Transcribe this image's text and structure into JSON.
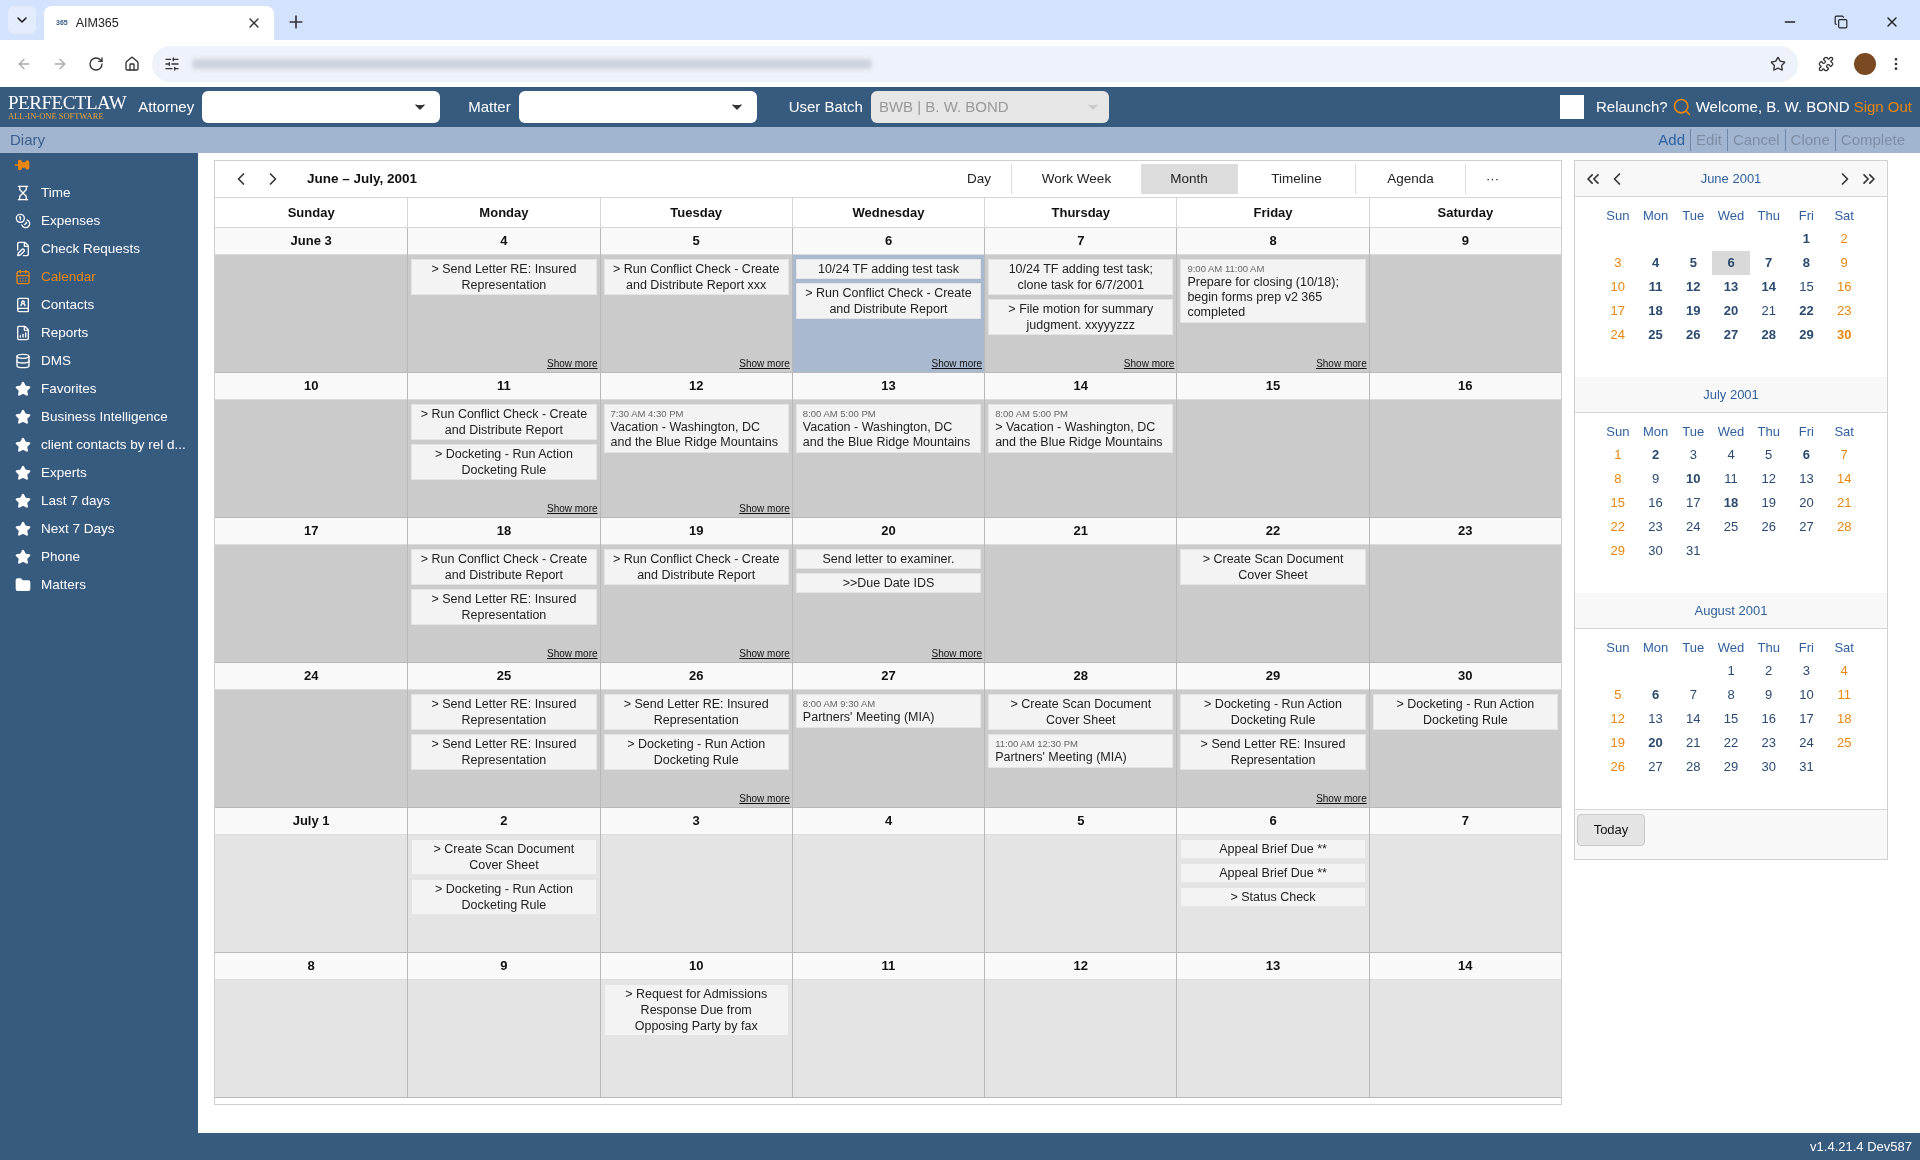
{
  "browser": {
    "tab_title": "AIM365",
    "favicon": "365"
  },
  "header": {
    "logo_top": "PERFECTLAW",
    "logo_bottom": "ALL-IN-ONE SOFTWARE",
    "attorney_label": "Attorney",
    "matter_label": "Matter",
    "batch_label": "User Batch",
    "batch_value": "BWB | B. W. BOND",
    "batch_disabled": true,
    "relaunch_checked": false,
    "relaunch_label": "Relaunch?",
    "welcome": "Welcome, B. W. BOND",
    "sign_out": "Sign Out"
  },
  "toolbar": {
    "title": "Diary",
    "actions": [
      {
        "label": "Add",
        "disabled": false
      },
      {
        "label": "Edit",
        "disabled": true
      },
      {
        "label": "Cancel",
        "disabled": true
      },
      {
        "label": "Clone",
        "disabled": true
      },
      {
        "label": "Complete",
        "disabled": true
      }
    ]
  },
  "sidebar": {
    "items": [
      {
        "label": "Time",
        "selected": false
      },
      {
        "label": "Expenses",
        "selected": false
      },
      {
        "label": "Check Requests",
        "selected": false
      },
      {
        "label": "Calendar",
        "selected": true
      },
      {
        "label": "Contacts",
        "selected": false
      },
      {
        "label": "Reports",
        "selected": false
      },
      {
        "label": "DMS",
        "selected": false
      },
      {
        "label": "Favorites",
        "selected": false
      },
      {
        "label": "Business Intelligence",
        "selected": false
      },
      {
        "label": "client contacts by rel d...",
        "selected": false
      },
      {
        "label": "Experts",
        "selected": false
      },
      {
        "label": "Last 7 days",
        "selected": false
      },
      {
        "label": "Next 7 Days",
        "selected": false
      },
      {
        "label": "Phone",
        "selected": false
      },
      {
        "label": "Matters",
        "selected": false
      }
    ]
  },
  "calendar": {
    "title": "June – July, 2001",
    "more": "···",
    "views": [
      {
        "label": "Day",
        "selected": false
      },
      {
        "label": "Work Week",
        "selected": false
      },
      {
        "label": "Month",
        "selected": true
      },
      {
        "label": "Timeline",
        "selected": false
      },
      {
        "label": "Agenda",
        "selected": false
      }
    ],
    "weekdays": [
      "Sunday",
      "Monday",
      "Tuesday",
      "Wednesday",
      "Thursday",
      "Friday",
      "Saturday"
    ],
    "weeks": [
      {
        "days": [
          {
            "date": "June 3",
            "in_month": true,
            "selected": false
          },
          {
            "date": "4",
            "in_month": true,
            "selected": false,
            "more": "Show more",
            "events": [
              {
                "kind": "task",
                "text": "> Send Letter RE: Insured Representation"
              }
            ]
          },
          {
            "date": "5",
            "in_month": true,
            "selected": false,
            "more": "Show more",
            "events": [
              {
                "kind": "task",
                "text": "> Run Conflict Check - Create and Distribute Report xxx"
              }
            ]
          },
          {
            "date": "6",
            "in_month": true,
            "selected": true,
            "more": "Show more",
            "events": [
              {
                "kind": "task",
                "text": "10/24 TF adding test task"
              },
              {
                "kind": "task",
                "text": "> Run Conflict Check - Create and Distribute Report"
              }
            ]
          },
          {
            "date": "7",
            "in_month": true,
            "selected": false,
            "more": "Show more",
            "events": [
              {
                "kind": "task",
                "text": "10/24 TF adding test task; clone task for 6/7/2001"
              },
              {
                "kind": "task",
                "text": "> File motion for summary judgment. xxyyyzzz"
              }
            ]
          },
          {
            "date": "8",
            "in_month": true,
            "selected": false,
            "more": "Show more",
            "events": [
              {
                "kind": "appointment",
                "time": "9:00 AM 11:00 AM",
                "text": "Prepare for closing (10/18); begin forms prep v2 365 completed"
              }
            ]
          },
          {
            "date": "9",
            "in_month": true,
            "selected": false
          }
        ]
      },
      {
        "days": [
          {
            "date": "10",
            "in_month": true,
            "selected": false
          },
          {
            "date": "11",
            "in_month": true,
            "selected": false,
            "more": "Show more",
            "events": [
              {
                "kind": "task",
                "text": "> Run Conflict Check - Create and Distribute Report"
              },
              {
                "kind": "task",
                "text": "> Docketing - Run Action Docketing Rule"
              }
            ]
          },
          {
            "date": "12",
            "in_month": true,
            "selected": false,
            "more": "Show more",
            "events": [
              {
                "kind": "appointment",
                "time": "7:30 AM 4:30 PM",
                "text": "Vacation - Washington, DC and the Blue Ridge Mountains"
              }
            ]
          },
          {
            "date": "13",
            "in_month": true,
            "selected": false,
            "events": [
              {
                "kind": "appointment",
                "time": "8:00 AM 5:00 PM",
                "text": "Vacation - Washington, DC and the Blue Ridge Mountains"
              }
            ]
          },
          {
            "date": "14",
            "in_month": true,
            "selected": false,
            "events": [
              {
                "kind": "appointment",
                "time": "8:00 AM 5:00 PM",
                "text": "> Vacation - Washington, DC and the Blue Ridge Mountains"
              }
            ]
          },
          {
            "date": "15",
            "in_month": true,
            "selected": false
          },
          {
            "date": "16",
            "in_month": true,
            "selected": false
          }
        ]
      },
      {
        "days": [
          {
            "date": "17",
            "in_month": true,
            "selected": false
          },
          {
            "date": "18",
            "in_month": true,
            "selected": false,
            "more": "Show more",
            "events": [
              {
                "kind": "task",
                "text": "> Run Conflict Check - Create and Distribute Report"
              },
              {
                "kind": "task",
                "text": "> Send Letter RE: Insured Representation"
              }
            ]
          },
          {
            "date": "19",
            "in_month": true,
            "selected": false,
            "more": "Show more",
            "events": [
              {
                "kind": "task",
                "text": "> Run Conflict Check - Create and Distribute Report"
              }
            ]
          },
          {
            "date": "20",
            "in_month": true,
            "selected": false,
            "more": "Show more",
            "events": [
              {
                "kind": "task",
                "text": "Send letter to examiner."
              },
              {
                "kind": "task",
                "text": ">>Due Date IDS"
              }
            ]
          },
          {
            "date": "21",
            "in_month": true,
            "selected": false
          },
          {
            "date": "22",
            "in_month": true,
            "selected": false,
            "events": [
              {
                "kind": "task",
                "text": "> Create Scan Document Cover Sheet"
              }
            ]
          },
          {
            "date": "23",
            "in_month": true,
            "selected": false
          }
        ]
      },
      {
        "days": [
          {
            "date": "24",
            "in_month": true,
            "selected": false
          },
          {
            "date": "25",
            "in_month": true,
            "selected": false,
            "events": [
              {
                "kind": "task",
                "text": "> Send Letter RE: Insured Representation"
              },
              {
                "kind": "task",
                "text": "> Send Letter RE: Insured Representation"
              }
            ]
          },
          {
            "date": "26",
            "in_month": true,
            "selected": false,
            "more": "Show more",
            "events": [
              {
                "kind": "task",
                "text": "> Send Letter RE: Insured Representation"
              },
              {
                "kind": "task",
                "text": "> Docketing - Run Action Docketing Rule"
              }
            ]
          },
          {
            "date": "27",
            "in_month": true,
            "selected": false,
            "events": [
              {
                "kind": "appointment",
                "time": "8:00 AM 9:30 AM",
                "text": "Partners' Meeting (MIA)"
              }
            ]
          },
          {
            "date": "28",
            "in_month": true,
            "selected": false,
            "events": [
              {
                "kind": "task",
                "text": "> Create Scan Document Cover Sheet"
              },
              {
                "kind": "appointment",
                "time": "11:00 AM 12:30 PM",
                "text": "Partners' Meeting (MIA)"
              }
            ]
          },
          {
            "date": "29",
            "in_month": true,
            "selected": false,
            "more": "Show more",
            "events": [
              {
                "kind": "task",
                "text": "> Docketing - Run Action Docketing Rule"
              },
              {
                "kind": "task",
                "text": "> Send Letter RE: Insured Representation"
              }
            ]
          },
          {
            "date": "30",
            "in_month": true,
            "selected": false,
            "events": [
              {
                "kind": "task",
                "text": "> Docketing - Run Action Docketing Rule"
              }
            ]
          }
        ]
      },
      {
        "days": [
          {
            "date": "July 1",
            "in_month": false,
            "selected": false
          },
          {
            "date": "2",
            "in_month": false,
            "selected": false,
            "events": [
              {
                "kind": "task",
                "text": "> Create Scan Document Cover Sheet"
              },
              {
                "kind": "task",
                "text": "> Docketing - Run Action Docketing Rule"
              }
            ]
          },
          {
            "date": "3",
            "in_month": false,
            "selected": false
          },
          {
            "date": "4",
            "in_month": false,
            "selected": false
          },
          {
            "date": "5",
            "in_month": false,
            "selected": false
          },
          {
            "date": "6",
            "in_month": false,
            "selected": false,
            "events": [
              {
                "kind": "task",
                "text": "Appeal Brief Due **"
              },
              {
                "kind": "task",
                "text": "Appeal Brief Due **"
              },
              {
                "kind": "task",
                "text": "> Status Check"
              }
            ]
          },
          {
            "date": "7",
            "in_month": false,
            "selected": false
          }
        ]
      },
      {
        "days": [
          {
            "date": "8",
            "in_month": false,
            "selected": false
          },
          {
            "date": "9",
            "in_month": false,
            "selected": false
          },
          {
            "date": "10",
            "in_month": false,
            "selected": false,
            "events": [
              {
                "kind": "task",
                "text": "> Request for Admissions Response Due from Opposing Party by fax"
              }
            ]
          },
          {
            "date": "11",
            "in_month": false,
            "selected": false
          },
          {
            "date": "12",
            "in_month": false,
            "selected": false
          },
          {
            "date": "13",
            "in_month": false,
            "selected": false
          },
          {
            "date": "14",
            "in_month": false,
            "selected": false
          }
        ]
      }
    ]
  },
  "mini_calendar": {
    "today": "Today",
    "months": [
      {
        "title": "June 2001",
        "weekdays": [
          "Sun",
          "Mon",
          "Tue",
          "Wed",
          "Thu",
          "Fri",
          "Sat"
        ],
        "weeks": [
          [
            {
              "day": "1",
              "bold": true,
              "selected": false
            },
            {
              "day": "2",
              "bold": false,
              "selected": false
            }
          ],
          [
            {
              "day": "3",
              "bold": false,
              "selected": false
            },
            {
              "day": "4",
              "bold": true,
              "selected": false
            },
            {
              "day": "5",
              "bold": true,
              "selected": false
            },
            {
              "day": "6",
              "bold": true,
              "selected": true
            },
            {
              "day": "7",
              "bold": true,
              "selected": false
            },
            {
              "day": "8",
              "bold": true,
              "selected": false
            },
            {
              "day": "9",
              "bold": false,
              "selected": false
            }
          ],
          [
            {
              "day": "10",
              "bold": false,
              "selected": false
            },
            {
              "day": "11",
              "bold": true,
              "selected": false
            },
            {
              "day": "12",
              "bold": true,
              "selected": false
            },
            {
              "day": "13",
              "bold": true,
              "selected": false
            },
            {
              "day": "14",
              "bold": true,
              "selected": false
            },
            {
              "day": "15",
              "bold": false,
              "selected": false
            },
            {
              "day": "16",
              "bold": false,
              "selected": false
            }
          ],
          [
            {
              "day": "17",
              "bold": false,
              "selected": false
            },
            {
              "day": "18",
              "bold": true,
              "selected": false
            },
            {
              "day": "19",
              "bold": true,
              "selected": false
            },
            {
              "day": "20",
              "bold": true,
              "selected": false
            },
            {
              "day": "21",
              "bold": false,
              "selected": false
            },
            {
              "day": "22",
              "bold": true,
              "selected": false
            },
            {
              "day": "23",
              "bold": false,
              "selected": false
            }
          ],
          [
            {
              "day": "24",
              "bold": false,
              "selected": false
            },
            {
              "day": "25",
              "bold": true,
              "selected": false
            },
            {
              "day": "26",
              "bold": true,
              "selected": false
            },
            {
              "day": "27",
              "bold": true,
              "selected": false
            },
            {
              "day": "28",
              "bold": true,
              "selected": false
            },
            {
              "day": "29",
              "bold": true,
              "selected": false
            },
            {
              "day": "30",
              "bold": true,
              "selected": false
            }
          ]
        ]
      },
      {
        "title": "July 2001",
        "weekdays": [
          "Sun",
          "Mon",
          "Tue",
          "Wed",
          "Thu",
          "Fri",
          "Sat"
        ],
        "weeks": [
          [
            {
              "day": "1",
              "bold": false,
              "selected": false
            },
            {
              "day": "2",
              "bold": true,
              "selected": false
            },
            {
              "day": "3",
              "bold": false,
              "selected": false
            },
            {
              "day": "4",
              "bold": false,
              "selected": false
            },
            {
              "day": "5",
              "bold": false,
              "selected": false
            },
            {
              "day": "6",
              "bold": true,
              "selected": false
            },
            {
              "day": "7",
              "bold": false,
              "selected": false
            }
          ],
          [
            {
              "day": "8",
              "bold": false,
              "selected": false
            },
            {
              "day": "9",
              "bold": false,
              "selected": false
            },
            {
              "day": "10",
              "bold": true,
              "selected": false
            },
            {
              "day": "11",
              "bold": false,
              "selected": false
            },
            {
              "day": "12",
              "bold": false,
              "selected": false
            },
            {
              "day": "13",
              "bold": false,
              "selected": false
            },
            {
              "day": "14",
              "bold": false,
              "selected": false
            }
          ],
          [
            {
              "day": "15",
              "bold": false,
              "selected": false
            },
            {
              "day": "16",
              "bold": false,
              "selected": false
            },
            {
              "day": "17",
              "bold": false,
              "selected": false
            },
            {
              "day": "18",
              "bold": true,
              "selected": false
            },
            {
              "day": "19",
              "bold": false,
              "selected": false
            },
            {
              "day": "20",
              "bold": false,
              "selected": false
            },
            {
              "day": "21",
              "bold": false,
              "selected": false
            }
          ],
          [
            {
              "day": "22",
              "bold": false,
              "selected": false
            },
            {
              "day": "23",
              "bold": false,
              "selected": false
            },
            {
              "day": "24",
              "bold": false,
              "selected": false
            },
            {
              "day": "25",
              "bold": false,
              "selected": false
            },
            {
              "day": "26",
              "bold": false,
              "selected": false
            },
            {
              "day": "27",
              "bold": false,
              "selected": false
            },
            {
              "day": "28",
              "bold": false,
              "selected": false
            }
          ],
          [
            {
              "day": "29",
              "bold": false,
              "selected": false
            },
            {
              "day": "30",
              "bold": false,
              "selected": false
            },
            {
              "day": "31",
              "bold": false,
              "selected": false
            }
          ]
        ]
      },
      {
        "title": "August 2001",
        "weekdays": [
          "Sun",
          "Mon",
          "Tue",
          "Wed",
          "Thu",
          "Fri",
          "Sat"
        ],
        "weeks": [
          [
            {
              "day": "1",
              "bold": false,
              "selected": false
            },
            {
              "day": "2",
              "bold": false,
              "selected": false
            },
            {
              "day": "3",
              "bold": false,
              "selected": false
            },
            {
              "day": "4",
              "bold": false,
              "selected": false
            }
          ],
          [
            {
              "day": "5",
              "bold": false,
              "selected": false
            },
            {
              "day": "6",
              "bold": true,
              "selected": false
            },
            {
              "day": "7",
              "bold": false,
              "selected": false
            },
            {
              "day": "8",
              "bold": false,
              "selected": false
            },
            {
              "day": "9",
              "bold": false,
              "selected": false
            },
            {
              "day": "10",
              "bold": false,
              "selected": false
            },
            {
              "day": "11",
              "bold": false,
              "selected": false
            }
          ],
          [
            {
              "day": "12",
              "bold": false,
              "selected": false
            },
            {
              "day": "13",
              "bold": false,
              "selected": false
            },
            {
              "day": "14",
              "bold": false,
              "selected": false
            },
            {
              "day": "15",
              "bold": false,
              "selected": false
            },
            {
              "day": "16",
              "bold": false,
              "selected": false
            },
            {
              "day": "17",
              "bold": false,
              "selected": false
            },
            {
              "day": "18",
              "bold": false,
              "selected": false
            }
          ],
          [
            {
              "day": "19",
              "bold": false,
              "selected": false
            },
            {
              "day": "20",
              "bold": true,
              "selected": false
            },
            {
              "day": "21",
              "bold": false,
              "selected": false
            },
            {
              "day": "22",
              "bold": false,
              "selected": false
            },
            {
              "day": "23",
              "bold": false,
              "selected": false
            },
            {
              "day": "24",
              "bold": false,
              "selected": false
            },
            {
              "day": "25",
              "bold": false,
              "selected": false
            }
          ],
          [
            {
              "day": "26",
              "bold": false,
              "selected": false
            },
            {
              "day": "27",
              "bold": false,
              "selected": false
            },
            {
              "day": "28",
              "bold": false,
              "selected": false
            },
            {
              "day": "29",
              "bold": false,
              "selected": false
            },
            {
              "day": "30",
              "bold": false,
              "selected": false
            },
            {
              "day": "31",
              "bold": false,
              "selected": false
            }
          ]
        ]
      }
    ]
  },
  "status_bar": {
    "version": "v1.4.21.4 Dev587"
  }
}
